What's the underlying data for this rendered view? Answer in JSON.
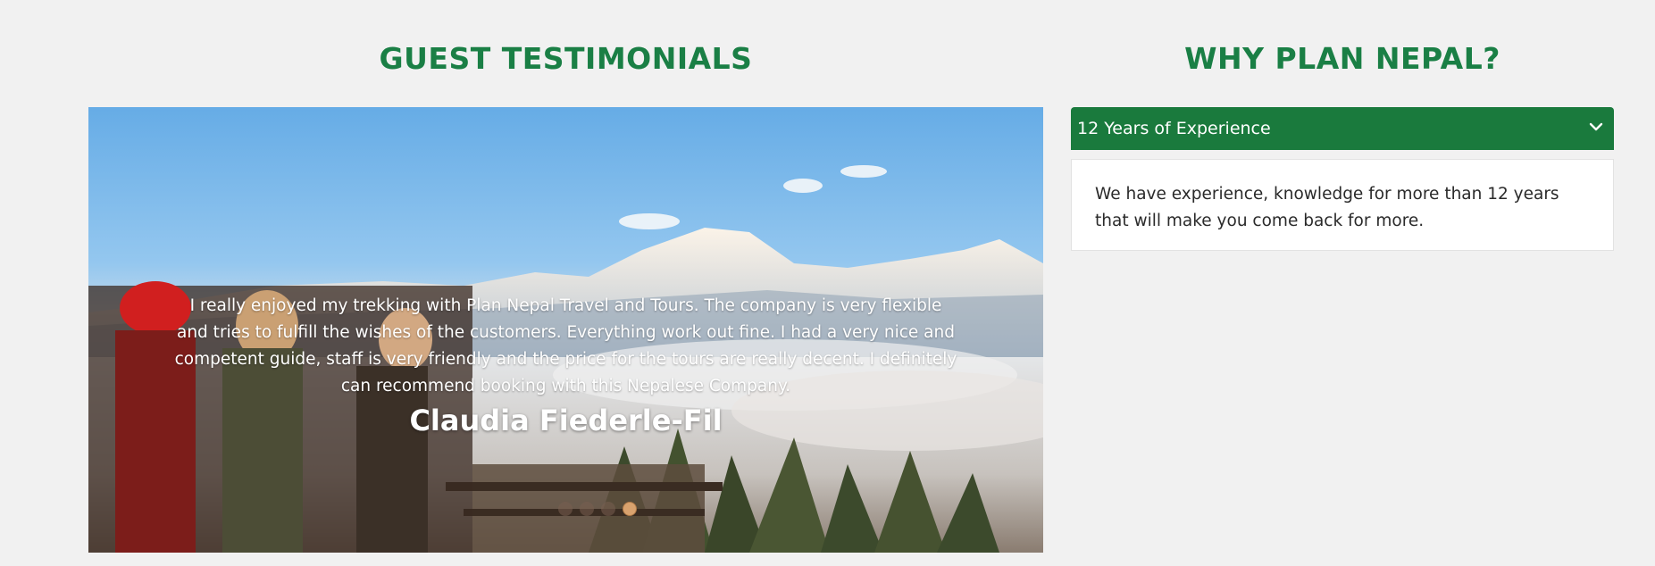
{
  "testimonials": {
    "title": "GUEST TESTIMONIALS",
    "quote": "I really enjoyed my trekking with Plan Nepal Travel and Tours. The company is very flexible and tries to fulfill the wishes of the customers. Everything work out fine. I had a very nice and competent guide, staff is very friendly and the price for the tours are really decent. I definitely can recommend booking with this Nepalese Company.",
    "author": "Claudia Fiederle-Fil",
    "indicators": {
      "count": 4,
      "active_index": 3
    }
  },
  "why": {
    "title": "WHY PLAN NEPAL?",
    "accordion": {
      "header": "12 Years of Experience",
      "icon": "chevron-down-icon",
      "body": "We have experience, knowledge for more than 12 years that will make you come back for more."
    }
  },
  "colors": {
    "accent": "#1a7f45",
    "accordion_header": "#1a7a3d",
    "background": "#f1f1f1",
    "active_indicator": "#d9a26e"
  }
}
